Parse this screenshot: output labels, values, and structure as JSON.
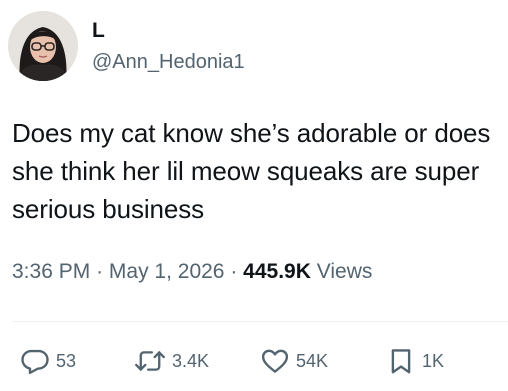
{
  "author": {
    "display_name": "L",
    "handle": "@Ann_Hedonia1",
    "avatar_icon": "profile-photo"
  },
  "tweet": {
    "text": "Does my cat know she’s adorable or does she think her lil meow squeaks are super serious business",
    "time": "3:36 PM",
    "separator1": "·",
    "date": "May 1, 2026",
    "separator2": "·",
    "views_count": "445.9K",
    "views_label": "Views"
  },
  "actions": {
    "reply": {
      "icon": "reply-icon",
      "count": "53"
    },
    "retweet": {
      "icon": "retweet-icon",
      "count": "3.4K"
    },
    "like": {
      "icon": "heart-icon",
      "count": "54K"
    },
    "bookmark": {
      "icon": "bookmark-icon",
      "count": "1K"
    }
  },
  "colors": {
    "text_primary": "#0f1419",
    "text_secondary": "#536471",
    "divider": "#eff3f4",
    "background": "#ffffff"
  }
}
